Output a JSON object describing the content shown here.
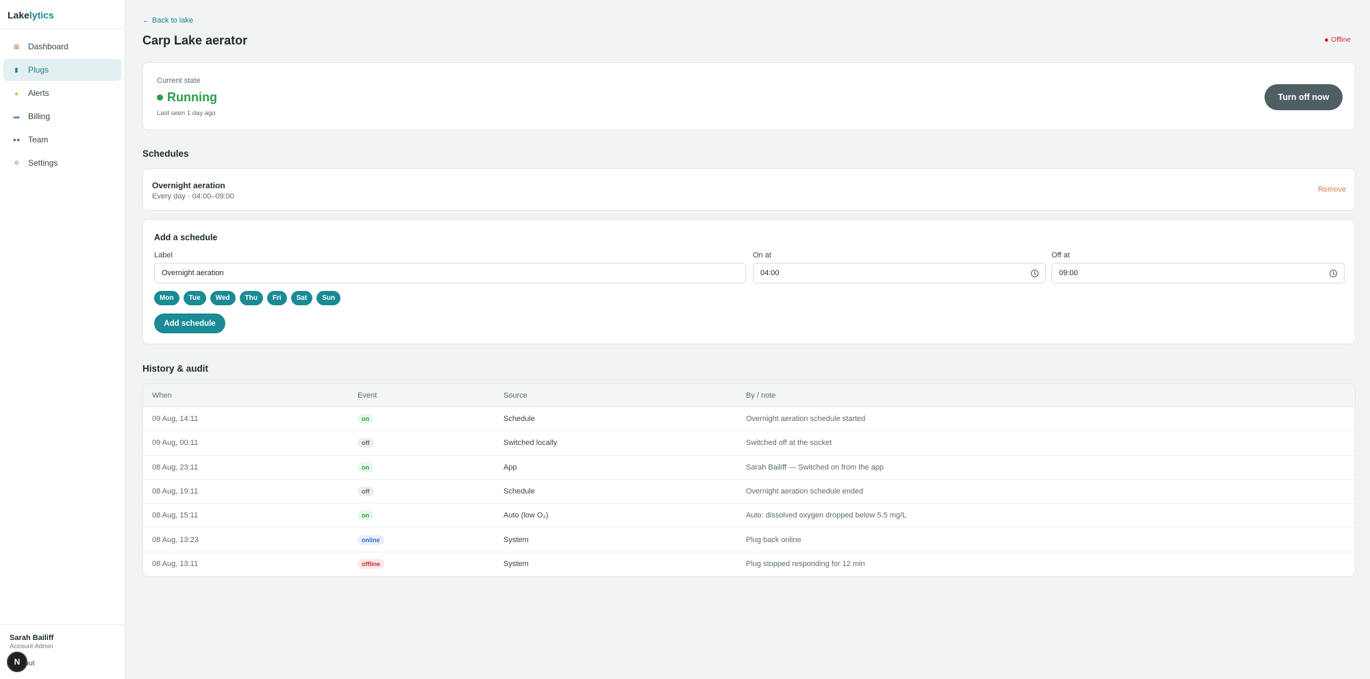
{
  "brand": {
    "part1": "Lake",
    "part2": "lytics"
  },
  "sidebar": {
    "items": [
      {
        "label": "Dashboard",
        "icon": "dashboard-icon",
        "glyph": "▦",
        "cls": "i-dashboard"
      },
      {
        "label": "Plugs",
        "icon": "plug-icon",
        "glyph": "▮",
        "cls": "i-plugs",
        "active": true
      },
      {
        "label": "Alerts",
        "icon": "bell-icon",
        "glyph": "▲",
        "cls": "i-alerts"
      },
      {
        "label": "Billing",
        "icon": "card-icon",
        "glyph": "▬",
        "cls": "i-billing"
      },
      {
        "label": "Team",
        "icon": "team-icon",
        "glyph": "●●",
        "cls": "i-team"
      },
      {
        "label": "Settings",
        "icon": "gear-icon",
        "glyph": "✲",
        "cls": "i-settings"
      }
    ],
    "user": {
      "name": "Sarah Bailiff",
      "role": "Account Admin",
      "logout": "out",
      "badge": "N"
    }
  },
  "header": {
    "back": "← Back to lake",
    "title": "Carp Lake aerator",
    "status": "Offline"
  },
  "state": {
    "label": "Current state",
    "value": "Running",
    "last_seen": "Last seen 1 day ago",
    "action": "Turn off now"
  },
  "schedules": {
    "title": "Schedules",
    "items": [
      {
        "name": "Overnight aeration",
        "when": "Every day · 04:00–09:00",
        "remove": "Remove"
      }
    ]
  },
  "add_schedule": {
    "title": "Add a schedule",
    "label_label": "Label",
    "label_value": "Overnight aeration",
    "on_label": "On at",
    "on_value": "04:00",
    "off_label": "Off at",
    "off_value": "09:00",
    "days": [
      "Mon",
      "Tue",
      "Wed",
      "Thu",
      "Fri",
      "Sat",
      "Sun"
    ],
    "submit": "Add schedule"
  },
  "history": {
    "title": "History & audit",
    "columns": [
      "When",
      "Event",
      "Source",
      "By / note"
    ],
    "rows": [
      {
        "when": "09 Aug, 14:11",
        "event": "on",
        "source": "Schedule",
        "note": "Overnight aeration schedule started"
      },
      {
        "when": "09 Aug, 00:11",
        "event": "off",
        "source": "Switched locally",
        "note": "Switched off at the socket"
      },
      {
        "when": "08 Aug, 23:11",
        "event": "on",
        "source": "App",
        "note": "Sarah Bailiff — Switched on from the app"
      },
      {
        "when": "08 Aug, 19:11",
        "event": "off",
        "source": "Schedule",
        "note": "Overnight aeration schedule ended"
      },
      {
        "when": "08 Aug, 15:11",
        "event": "on",
        "source": "Auto (low O₂)",
        "note": "Auto: dissolved oxygen dropped below 5.5 mg/L"
      },
      {
        "when": "08 Aug, 13:23",
        "event": "online",
        "source": "System",
        "note": "Plug back online"
      },
      {
        "when": "08 Aug, 13:11",
        "event": "offline",
        "source": "System",
        "note": "Plug stopped responding for 12 min"
      }
    ]
  },
  "colors": {
    "accent": "#1a8a94",
    "running": "#2a9d4a",
    "offline": "#d12b2b",
    "remove": "#e07a4f"
  }
}
